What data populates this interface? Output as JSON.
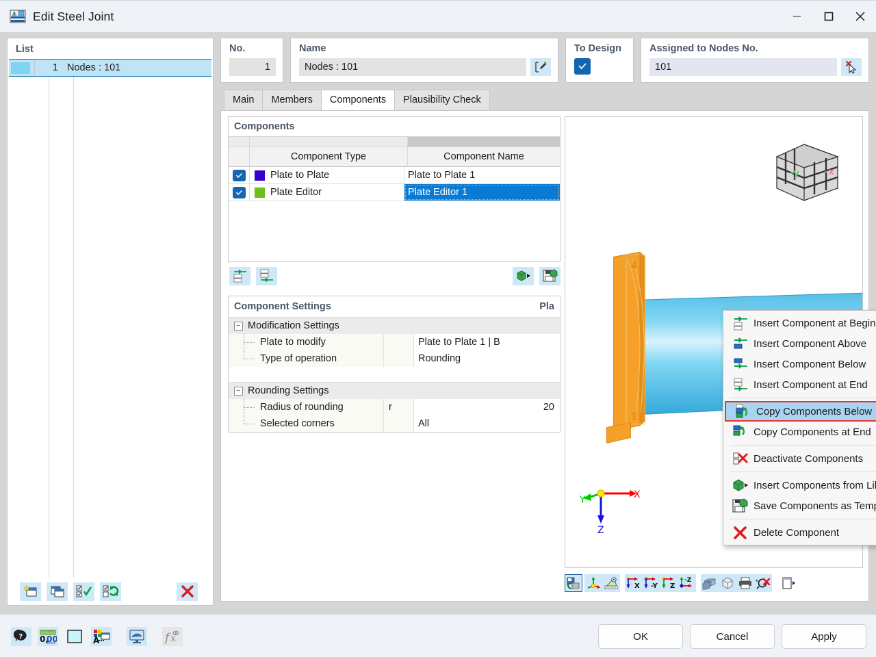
{
  "window": {
    "title": "Edit Steel Joint",
    "icon": "steel-joint-icon",
    "minimize": "—",
    "maximize": "☐",
    "close": "✕"
  },
  "list_panel": {
    "header": "List",
    "rows": [
      {
        "no": "1",
        "label": "Nodes : 101"
      }
    ],
    "toolbar": [
      {
        "name": "new-joint-button",
        "icon": "new-window-icon"
      },
      {
        "name": "copy-joint-button",
        "icon": "copy-window-icon"
      },
      {
        "name": "select-all-button",
        "icon": "checkall-icon"
      },
      {
        "name": "invert-selection-button",
        "icon": "invert-check-icon"
      },
      {
        "name": "delete-joint-button",
        "icon": "red-x-icon"
      }
    ]
  },
  "header_fields": {
    "no": {
      "label": "No.",
      "value": "1"
    },
    "name": {
      "label": "Name",
      "value": "Nodes : 101",
      "edit_icon": "edit-pencil-icon"
    },
    "to_design": {
      "label": "To Design",
      "checked": true
    },
    "assigned": {
      "label": "Assigned to Nodes No.",
      "value": "101",
      "pick_icon": "pick-cursor-icon"
    }
  },
  "tabs": [
    {
      "label": "Main",
      "active": false
    },
    {
      "label": "Members",
      "active": false
    },
    {
      "label": "Components",
      "active": true
    },
    {
      "label": "Plausibility Check",
      "active": false
    }
  ],
  "components_grid": {
    "title": "Components",
    "columns": [
      "",
      "Component Type",
      "Component Name"
    ],
    "rows": [
      {
        "checked": true,
        "color": "#3300cc",
        "type": "Plate to Plate",
        "name": "Plate to Plate 1",
        "selected": false
      },
      {
        "checked": true,
        "color": "#6cbf1a",
        "type": "Plate Editor",
        "name": "Plate Editor 1",
        "selected": true
      }
    ],
    "toolbar": [
      {
        "name": "insert-component-beginning-button",
        "icon": "insert-top-icon"
      },
      {
        "name": "insert-component-end-button",
        "icon": "insert-bottom-icon"
      },
      {
        "name": "insert-from-library-button",
        "icon": "library-icon"
      },
      {
        "name": "save-as-template-button",
        "icon": "save-template-icon"
      }
    ]
  },
  "component_settings": {
    "title": "Component Settings",
    "right_title": "Pla",
    "groups": [
      {
        "name": "Modification Settings",
        "rows": [
          {
            "label": "Plate to modify",
            "symbol": "",
            "value": "Plate to Plate 1 | B",
            "align": "left"
          },
          {
            "label": "Type of operation",
            "symbol": "",
            "value": "Rounding",
            "align": "left"
          }
        ]
      },
      {
        "name": "Rounding Settings",
        "rows": [
          {
            "label": "Radius of rounding",
            "symbol": "r",
            "value": "20",
            "align": "right"
          },
          {
            "label": "Selected corners",
            "symbol": "",
            "value": "All",
            "align": "left"
          }
        ]
      }
    ]
  },
  "viewport": {
    "nav_cube_labels": {
      "y": "-y",
      "x": "-x"
    },
    "axis_labels": {
      "x": "X",
      "y": "Y",
      "z": "Z"
    },
    "plate_numbers": [
      "4",
      "1"
    ],
    "toolbar": [
      {
        "name": "rotate-view-button",
        "icon": "rotate-icon",
        "selected": true
      },
      {
        "name": "show-axes-button",
        "icon": "axes-icon"
      },
      {
        "name": "measure-button",
        "icon": "measure-icon"
      },
      {
        "name": "view-x-button",
        "icon": "axis-x-icon",
        "label": "X"
      },
      {
        "name": "view-minus-y-button",
        "icon": "axis-y-icon",
        "label": "-Y"
      },
      {
        "name": "view-z-button",
        "icon": "axis-z-icon",
        "label": "Z"
      },
      {
        "name": "view-minus-z-button",
        "icon": "axis-minus-z-icon",
        "label": "-Z"
      },
      {
        "name": "shaded-view-button",
        "icon": "solid-icon"
      },
      {
        "name": "wireframe-view-button",
        "icon": "wireframe-icon"
      },
      {
        "name": "print-button",
        "icon": "printer-icon"
      },
      {
        "name": "zoom-reset-button",
        "icon": "zoom-x-icon"
      },
      {
        "name": "expand-view-button",
        "icon": "expand-panel-icon"
      }
    ]
  },
  "context_menu": {
    "items": [
      {
        "label": "Insert Component at Beginning",
        "icon": "insert-beginning-icon",
        "highlighted": false,
        "separator_after": false
      },
      {
        "label": "Insert Component Above",
        "icon": "insert-above-icon",
        "highlighted": false,
        "separator_after": false
      },
      {
        "label": "Insert Component Below",
        "icon": "insert-below-icon",
        "highlighted": false,
        "separator_after": false
      },
      {
        "label": "Insert Component at End",
        "icon": "insert-end-icon",
        "highlighted": false,
        "separator_after": true
      },
      {
        "label": "Copy Components Below",
        "icon": "copy-below-icon",
        "highlighted": true,
        "separator_after": false
      },
      {
        "label": "Copy Components at End",
        "icon": "copy-end-icon",
        "highlighted": false,
        "separator_after": true
      },
      {
        "label": "Deactivate Components",
        "icon": "deactivate-icon",
        "highlighted": false,
        "separator_after": true
      },
      {
        "label": "Insert Components from Library",
        "icon": "library-icon",
        "highlighted": false,
        "separator_after": false
      },
      {
        "label": "Save Components as Template",
        "icon": "save-template-icon",
        "highlighted": false,
        "separator_after": true
      },
      {
        "label": "Delete Component",
        "icon": "delete-x-icon",
        "highlighted": false,
        "separator_after": false
      }
    ]
  },
  "bottom_bar": {
    "tools": [
      {
        "name": "help-button",
        "icon": "help-balloon-icon"
      },
      {
        "name": "units-button",
        "icon": "units-icon"
      },
      {
        "name": "color-swatch-button",
        "icon": "color-swatch-icon"
      },
      {
        "name": "display-properties-button",
        "icon": "display-props-icon"
      },
      {
        "name": "render-button",
        "icon": "render-icon"
      },
      {
        "name": "formula-button",
        "icon": "formula-icon"
      }
    ],
    "buttons": [
      {
        "label": "OK",
        "name": "ok-button"
      },
      {
        "label": "Cancel",
        "name": "cancel-button"
      },
      {
        "label": "Apply",
        "name": "apply-button"
      }
    ]
  },
  "colors": {
    "accent": "#0a7bd4",
    "highlight_red": "#e8332a",
    "menu_highlight": "#a8d4f2",
    "header_text": "#4a5568"
  }
}
